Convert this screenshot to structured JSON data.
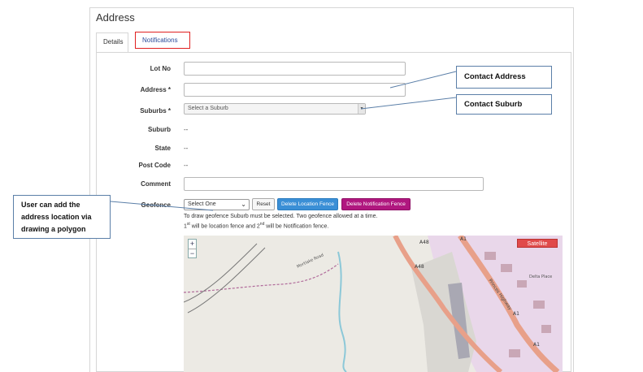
{
  "panel": {
    "title": "Address"
  },
  "tabs": [
    {
      "label": "Details",
      "active": true
    },
    {
      "label": "Notifications",
      "active": false
    }
  ],
  "form": {
    "lot_no": {
      "label": "Lot No",
      "value": ""
    },
    "address": {
      "label": "Address *",
      "value": ""
    },
    "suburbs": {
      "label": "Suburbs *",
      "placeholder": "Select a Suburb"
    },
    "suburb": {
      "label": "Suburb",
      "value": "--"
    },
    "state": {
      "label": "State",
      "value": "--"
    },
    "post_code": {
      "label": "Post Code",
      "value": "--"
    },
    "comment": {
      "label": "Comment",
      "value": ""
    },
    "geofence": {
      "label": "Geofence",
      "selected": "Select One",
      "reset_label": "Reset",
      "delete_location_label": "Delete Location Fence",
      "delete_notification_label": "Delete Notification Fence",
      "help_line1": "To draw geofence Suburb must be selected. Two geofence allowed at a time.",
      "help_line2_a": "1",
      "help_line2_sup_a": "st",
      "help_line2_b": " will be location fence and 2",
      "help_line2_sup_b": "nd",
      "help_line2_c": " will be Notification fence."
    }
  },
  "map": {
    "zoom_in": "+",
    "zoom_out": "−",
    "satellite_label": "Satellite",
    "road_labels": [
      "A48",
      "A48",
      "A1",
      "A1",
      "A1",
      "Princes Highway",
      "Delta Place",
      "Mortlake Road"
    ]
  },
  "callouts": {
    "contact_address": "Contact Address",
    "contact_suburb": "Contact Suburb",
    "user_line1": "User can add the",
    "user_line2": "address location via",
    "user_line3": "drawing a polygon"
  },
  "colors": {
    "callout_border": "#5b7fa8",
    "tab_highlight": "#e02020",
    "delete_location": "#3a8fd6",
    "delete_notification": "#b0177f",
    "satellite_button": "#e04a4a"
  }
}
